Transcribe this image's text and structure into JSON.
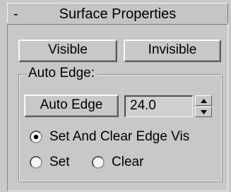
{
  "rollout": {
    "collapse_symbol": "-",
    "title": "Surface Properties"
  },
  "buttons": {
    "visible": "Visible",
    "invisible": "Invisible"
  },
  "auto_edge": {
    "group_label": "Auto Edge:",
    "button_label": "Auto Edge",
    "threshold_value": "24.0",
    "options": [
      {
        "label": "Set And Clear Edge Vis",
        "selected": true
      },
      {
        "label": "Set",
        "selected": false
      },
      {
        "label": "Clear",
        "selected": false
      }
    ]
  }
}
